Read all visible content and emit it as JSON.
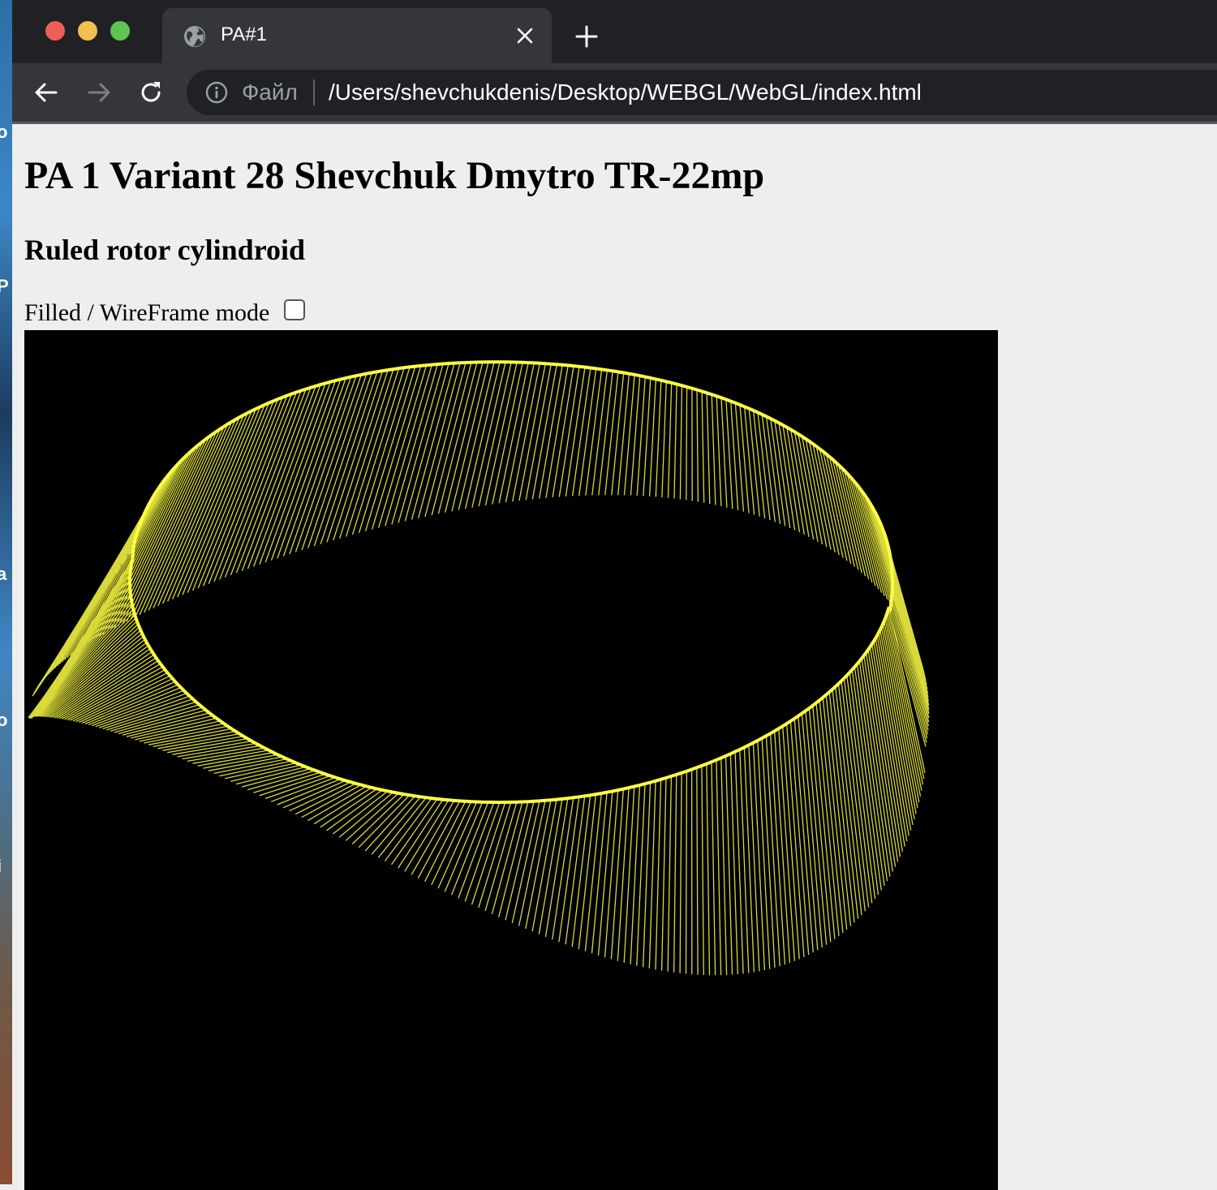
{
  "browser": {
    "tab_title": "PA#1",
    "scheme_label": "Файл",
    "url": "/Users/shevchukdenis/Desktop/WEBGL/WebGL/index.html"
  },
  "page": {
    "title": "PA 1 Variant 28 Shevchuk Dmytro TR-22mp",
    "subtitle": "Ruled rotor cylindroid",
    "mode_label": "Filled / WireFrame mode",
    "mode_checked": false
  },
  "desktop_fragments": [
    "o",
    "P",
    "a",
    "o",
    "i"
  ],
  "colors": {
    "surface": "#ffff44",
    "canvas_bg": "#000000",
    "page_bg": "#eeeeee",
    "chrome_dark": "#202124",
    "chrome_tab": "#35363a"
  },
  "icons": [
    "globe-icon",
    "close-icon",
    "plus-icon",
    "back-arrow-icon",
    "forward-arrow-icon",
    "reload-icon",
    "info-icon"
  ]
}
